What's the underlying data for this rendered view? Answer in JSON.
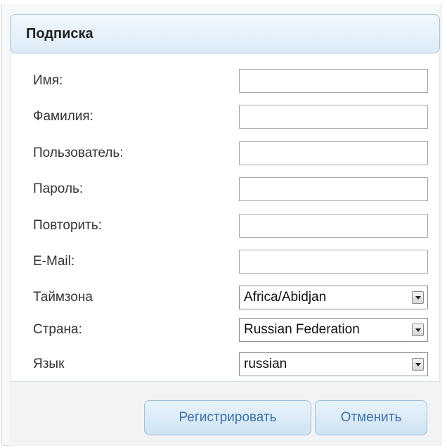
{
  "header": {
    "title": "Подписка"
  },
  "fields": {
    "first_name": {
      "label": "Имя:",
      "value": ""
    },
    "last_name": {
      "label": "Фамилия:",
      "value": ""
    },
    "username": {
      "label": "Пользователь:",
      "value": ""
    },
    "password": {
      "label": "Пароль:",
      "value": ""
    },
    "repeat_password": {
      "label": "Повторить:",
      "value": ""
    },
    "email": {
      "label": "E-Mail:",
      "value": ""
    },
    "timezone": {
      "label": "Таймзона",
      "value": "Africa/Abidjan"
    },
    "country": {
      "label": "Страна:",
      "value": "Russian Federation"
    },
    "language": {
      "label": "Язык",
      "value": "russian"
    }
  },
  "buttons": {
    "register": "Регистрировать",
    "cancel": "Отменить"
  },
  "colors": {
    "header_bg": "#dcebf7",
    "button_text": "#3c72a8",
    "input_border": "#a7a7a7"
  },
  "icons": {
    "select_arrow": "chevron-down-icon"
  }
}
